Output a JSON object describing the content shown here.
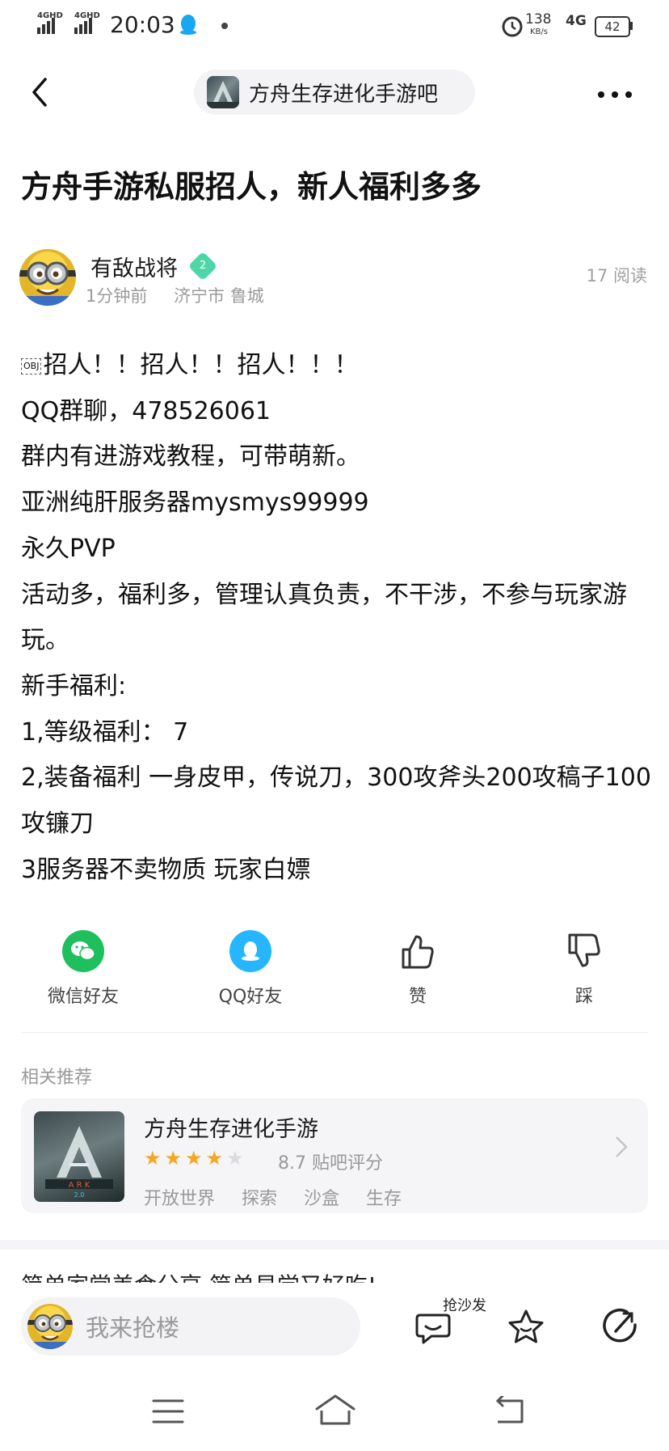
{
  "status_bar": {
    "signal_1": "4GHD",
    "signal_2": "4GHD",
    "time": "20:03",
    "net_speed": "138",
    "net_unit": "KB/s",
    "network": "4G",
    "battery": "42"
  },
  "header": {
    "forum_name": "方舟生存进化手游吧"
  },
  "post": {
    "title": "方舟手游私服招人，新人福利多多",
    "author": "有敌战将",
    "level": "2",
    "time_ago": "1分钟前",
    "location": "济宁市 鲁城",
    "reads": "17 阅读",
    "lines": [
      "招人！！招人！！招人！！！",
      "QQ群聊，478526061",
      "群内有进游戏教程，可带萌新。",
      "亚洲纯肝服务器mysmys99999",
      "永久PVP",
      "活动多，福利多，管理认真负责，不干涉，不参与玩家游玩。",
      "新手福利:",
      "1,等级福利： 7",
      "2,装备福利 一身皮甲，传说刀，300攻斧头200攻稿子100攻镰刀",
      "3服务器不卖物质 玩家白嫖"
    ],
    "obj_label": "OBJ"
  },
  "share": {
    "wechat": "微信好友",
    "qq": "QQ好友",
    "like": "赞",
    "dislike": "踩"
  },
  "related": {
    "section_title": "相关推荐",
    "game_name": "方舟生存进化手游",
    "score_text": "8.7 贴吧评分",
    "rating": 4,
    "rating_max": 5,
    "tags": [
      "开放世界",
      "探索",
      "沙盒",
      "生存"
    ]
  },
  "next_post_peek": "简单家常美食分享 简单易学又好吃!",
  "comment_bar": {
    "placeholder": "我来抢楼",
    "sofa_label": "抢沙发"
  },
  "colors": {
    "wechat_green": "#1fbf5e",
    "qq_blue": "#26b5ff",
    "star_orange": "#f5a623",
    "badge_teal": "#4fd6a6"
  }
}
